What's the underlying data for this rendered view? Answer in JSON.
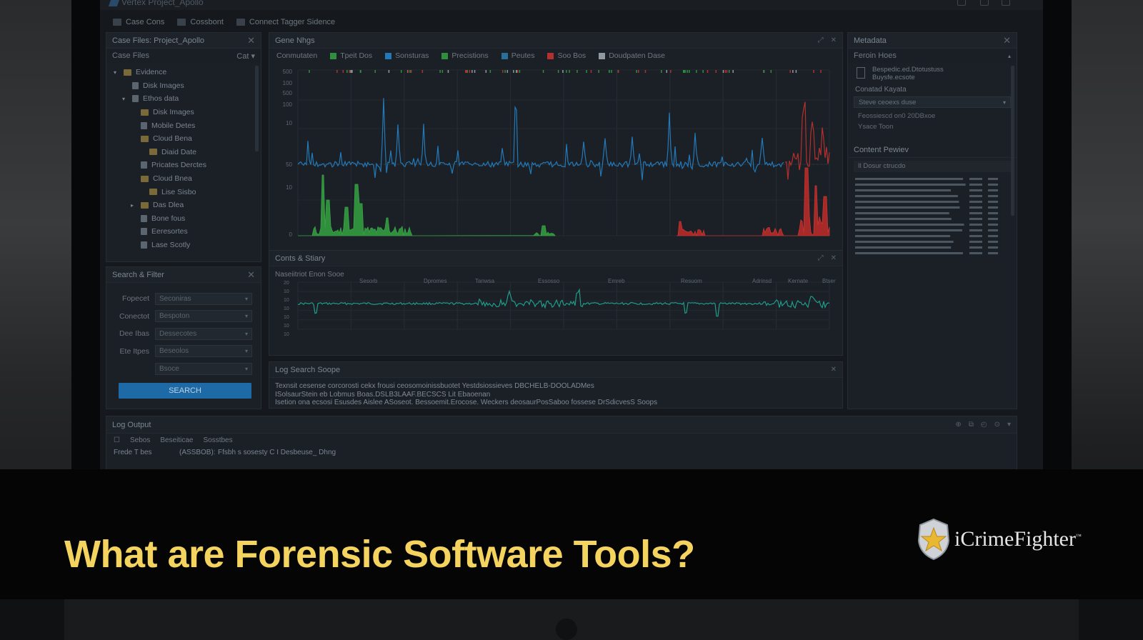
{
  "app": {
    "window_title": "Vertex Project_Apollo",
    "toolbar": [
      {
        "label": "Case Cons",
        "icon": "cases-icon"
      },
      {
        "label": "Cossbont",
        "icon": "dashboard-icon"
      },
      {
        "label": "Connect Tagger Sidence",
        "icon": "connect-icon"
      }
    ]
  },
  "case_files": {
    "title": "Case Files: Project_Apollo",
    "subheader": "Case Files",
    "subheader_right": "Cat ▾",
    "tree": [
      {
        "label": "Evidence",
        "type": "folder",
        "indent": 0,
        "arrow": "▾"
      },
      {
        "label": "Disk Images",
        "type": "doc",
        "indent": 1,
        "arrow": ""
      },
      {
        "label": "Ethos data",
        "type": "doc",
        "indent": 1,
        "arrow": "▾"
      },
      {
        "label": "Disk Images",
        "type": "folder",
        "indent": 2,
        "arrow": ""
      },
      {
        "label": "Mobile Detes",
        "type": "doc",
        "indent": 2,
        "arrow": ""
      },
      {
        "label": "Cloud Bena",
        "type": "folder",
        "indent": 2,
        "arrow": ""
      },
      {
        "label": "Diaid Date",
        "type": "folder",
        "indent": 3,
        "arrow": ""
      },
      {
        "label": "Pricates Derctes",
        "type": "doc",
        "indent": 2,
        "arrow": ""
      },
      {
        "label": "Cloud Bnea",
        "type": "folder",
        "indent": 2,
        "arrow": ""
      },
      {
        "label": "Lise Sisbo",
        "type": "folder",
        "indent": 3,
        "arrow": ""
      },
      {
        "label": "Das Dlea",
        "type": "folder",
        "indent": 2,
        "arrow": "▸"
      },
      {
        "label": "Bone fous",
        "type": "doc",
        "indent": 2,
        "arrow": ""
      },
      {
        "label": "Eeresortes",
        "type": "doc",
        "indent": 2,
        "arrow": ""
      },
      {
        "label": "Lase Scotly",
        "type": "doc",
        "indent": 2,
        "arrow": ""
      }
    ]
  },
  "search_filter": {
    "title": "Search & Filter",
    "fields": [
      {
        "label": "Fopecet",
        "value": "Seconiras"
      },
      {
        "label": "Conectot",
        "value": "Bespoton"
      },
      {
        "label": "Dee Ibas",
        "value": "Dessecotes"
      },
      {
        "label": "Ete Itpes",
        "value": "Beseolos"
      },
      {
        "label": "",
        "value": "Bsoce"
      }
    ],
    "button": "SEARCH"
  },
  "main_chart": {
    "title": "Gene Nhgs",
    "legend": [
      {
        "label": "Conmutaten",
        "color": ""
      },
      {
        "label": "Tpeit Dos",
        "color": "#2f8f3c"
      },
      {
        "label": "Sonsturas",
        "color": "#2379b8"
      },
      {
        "label": "Precistions",
        "color": "#2f8f3c"
      },
      {
        "label": "Peutes",
        "color": "#2a6f9a"
      },
      {
        "label": "Soo Bos",
        "color": "#b3302e"
      },
      {
        "label": "Doudpaten Dase",
        "color": "#9098a0"
      }
    ],
    "yticks_top": [
      "500",
      "100",
      "500",
      "100",
      "10",
      "50"
    ],
    "yticks_bottom": [
      "10",
      "0"
    ]
  },
  "mid_chart": {
    "title": "Conts & Stiary",
    "subtitle": "Naseiitriot Enon Sooe",
    "annotations": [
      "Sesorb",
      "Dpromes",
      "Tanwsa",
      "Essosso",
      "Emreb",
      "Resuom",
      "Adrinsd",
      "Kernate",
      "Btser"
    ],
    "yticks": [
      "20",
      "10",
      "10",
      "10",
      "10",
      "10",
      "10"
    ]
  },
  "log_search": {
    "title": "Log Search Soope",
    "lines": [
      "Texnsit cesense  corcorosti cekx  frousi  ceosomoinissbuotet  Yestdsiossieves  DBCHELB-DOOLADMes",
      "ISolsaurStein  eb  Lobmus  Boas.DSLB3LAAF.BECSCS  Lit  Ebaoenan",
      "Isetion  ona  ecsosi  Esusdes  Aislee  ASoseot.  Bessoemit.Erocose.  Weckers  deosaurPosSaboo  fossese  DrSdicvesS  Soops"
    ]
  },
  "metadata": {
    "title": "Metadata",
    "section1": "Feroin Hoes",
    "file_lines": [
      "Bespedic.ed.Dtotustuss",
      "Buysfe.ecsote"
    ],
    "section2": "Conatad Kayata",
    "select_value": "Steve ceoexs duse",
    "items": [
      "Feossiescd  on0  20DBxoe",
      "Ysace Toon"
    ],
    "preview_title": "Content Pewiev",
    "preview_item": "Il Dosur ctrucdo"
  },
  "log_output": {
    "title": "Log Output",
    "tabs": [
      "Sebos",
      "Beseiticae",
      "Sosstbes"
    ],
    "rows": [
      {
        "c1": "Frede T bes",
        "c2": "(ASSBOB):",
        "c3": "Ffsbh  s  sosesty  C I Desbeuse_  Dhng"
      }
    ]
  },
  "banner": {
    "title": "What are Forensic Software Tools?",
    "brand": "iCrimeFighter",
    "brand_mark": "™"
  },
  "colors": {
    "accent_title": "#f4d35e",
    "blue_series": "#2379b8",
    "green_series": "#2f8f3c",
    "red_series": "#b3302e",
    "teal_series": "#1f9c8a"
  }
}
